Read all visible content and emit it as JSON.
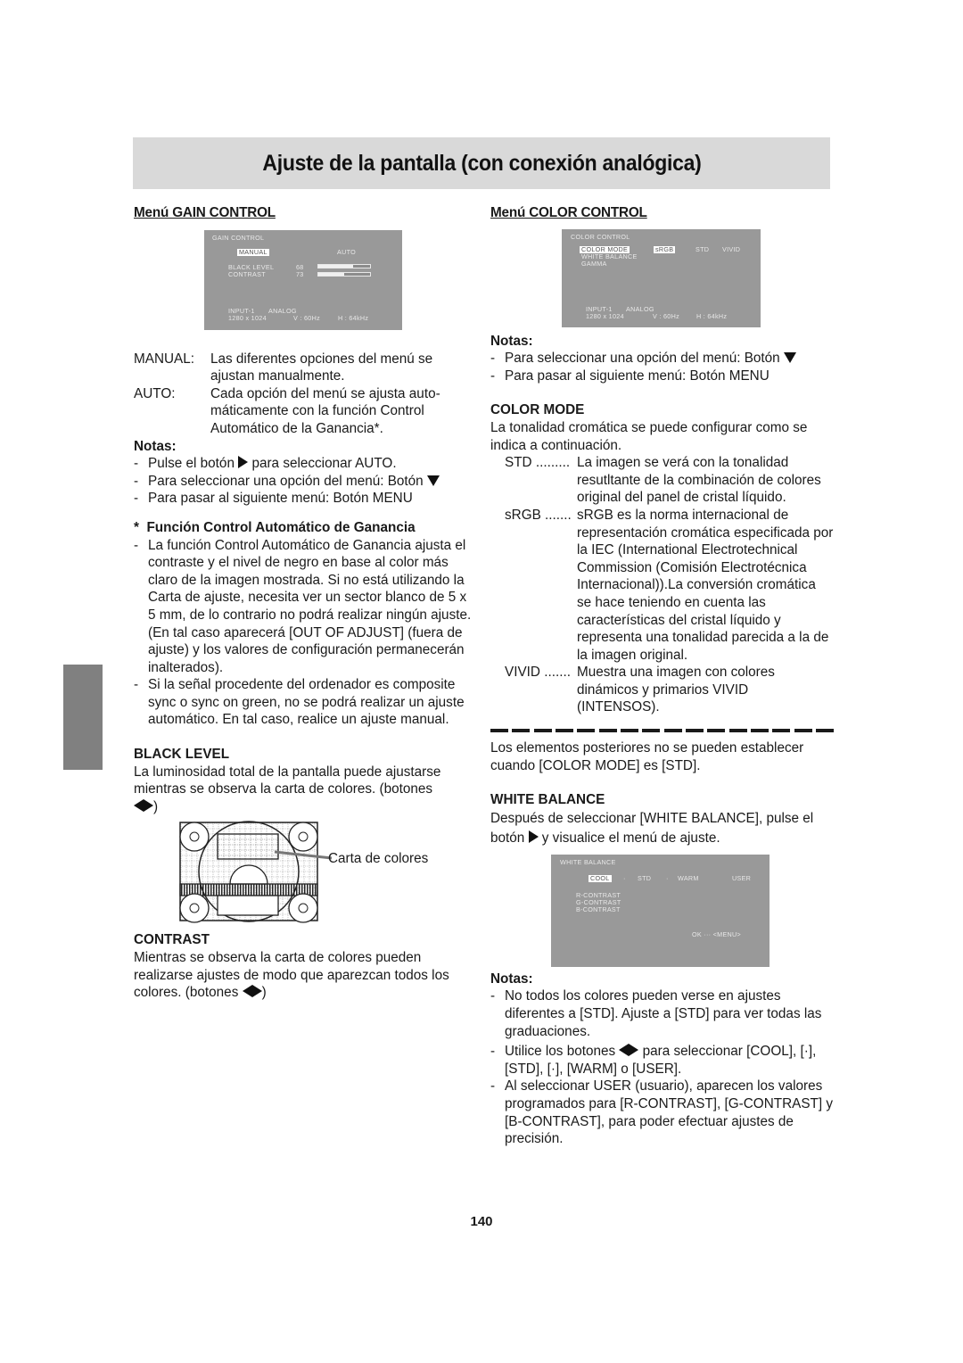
{
  "page": {
    "title": "Ajuste de la pantalla (con conexión analógica)",
    "page_number": "140"
  },
  "left": {
    "heading": "Menú GAIN CONTROL",
    "osd": {
      "title": "GAIN CONTROL",
      "options": [
        "MANUAL",
        "AUTO"
      ],
      "selected": "MANUAL",
      "items": [
        {
          "label": "BLACK LEVEL",
          "value": "68",
          "fraction": 0.68
        },
        {
          "label": "CONTRAST",
          "value": "73",
          "fraction": 0.5
        }
      ],
      "input": "INPUT-1",
      "signal": "ANALOG",
      "resolution": "1280  x 1024",
      "vfreq": "V : 60Hz",
      "hfreq": "H : 64kHz"
    },
    "defs": [
      {
        "term": "MANUAL:",
        "desc": "Las diferentes opciones del menú se ajustan manualmente."
      },
      {
        "term": "AUTO:",
        "desc": "Cada opción del menú se ajusta auto-máticamente con la función Control Automático de la Ganancia*."
      }
    ],
    "notes_title": "Notas:",
    "notes": [
      {
        "pre": "Pulse el botón",
        "icon": "right",
        "post": "para seleccionar AUTO."
      },
      {
        "pre": "Para seleccionar una opción del menú: Botón",
        "icon": "down",
        "post": ""
      },
      {
        "pre": "Para pasar al siguiente menú: Botón MENU",
        "icon": "",
        "post": ""
      }
    ],
    "agc_title": "*  Función Control Automático de Ganancia",
    "agc_notes": [
      "La función Control Automático de Ganancia ajusta el contraste y el nivel de negro en base al color más claro de la imagen mostrada. Si no está utilizando la Carta de ajuste, necesita ver un sector blanco de 5 x 5 mm, de lo contrario no podrá realizar ningún ajuste. (En tal caso aparecerá [OUT OF ADJUST] (fuera de ajuste) y los valores de configuración permanecerán inalterados).",
      "Si la señal procedente del ordenador es composite sync o sync on green, no se podrá realizar un ajuste automático. En tal caso, realice un ajuste manual."
    ],
    "black_level": {
      "title": "BLACK LEVEL",
      "text": "La luminosidad total de la pantalla puede ajustarse mientras se observa la carta de colores. (botones",
      "close": ")"
    },
    "chart_callout": "Carta de colores",
    "contrast": {
      "title": "CONTRAST",
      "text": "Mientras se observa la carta de colores pueden realizarse ajustes de modo que aparezcan todos los colores. (botones",
      "close": ")"
    }
  },
  "right": {
    "heading": "Menú COLOR CONTROL",
    "osd": {
      "title": "COLOR CONTROL",
      "items": [
        "COLOR MODE",
        "WHITE BALANCE",
        "GAMMA"
      ],
      "mode_options": [
        "sRGB",
        "STD",
        "VIVID"
      ],
      "selected_item": "COLOR MODE",
      "selected_mode": "sRGB",
      "input": "INPUT-1",
      "signal": "ANALOG",
      "resolution": "1280  x 1024",
      "vfreq": "V : 60Hz",
      "hfreq": "H : 64kHz"
    },
    "notes_title": "Notas:",
    "notes": [
      {
        "pre": "Para seleccionar una opción del menú: Botón",
        "icon": "down",
        "post": ""
      },
      {
        "pre": "Para pasar al siguiente menú: Botón MENU",
        "icon": "",
        "post": ""
      }
    ],
    "color_mode": {
      "title": "COLOR MODE",
      "intro": "La tonalidad cromática se puede configurar como se indica a continuación.",
      "modes": [
        {
          "term": "STD .........",
          "desc": "La imagen se verá con la tonalidad resutltante de la combinación de colores original del panel de cristal líquido."
        },
        {
          "term": "sRGB .......",
          "desc": "sRGB es la norma internacional de representación cromática especificada por la IEC (International Electrotechnical Commission (Comisión Electrotécnica Internacional)).La conversión cromática se hace teniendo en cuenta las características del cristal líquido y representa una tonalidad parecida a la de la imagen original."
        },
        {
          "term": "VIVID .......",
          "desc": "Muestra una imagen con colores dinámicos y primarios VIVID (INTENSOS)."
        }
      ]
    },
    "std_note": "Los elementos posteriores no se pueden establecer cuando [COLOR MODE] es [STD].",
    "white_balance": {
      "title": "WHITE BALANCE",
      "text_pre": "Después de seleccionar [WHITE BALANCE], pulse el botón",
      "text_post": "y visualice el menú de ajuste.",
      "osd": {
        "title": "WHITE BALANCE",
        "options": [
          "COOL",
          "·",
          "STD",
          "·",
          "WARM",
          "USER"
        ],
        "selected": "COOL",
        "items": [
          "R-CONTRAST",
          "G-CONTRAST",
          "B-CONTRAST"
        ],
        "footer": "OK ··· <MENU>"
      }
    },
    "notes2_title": "Notas:",
    "notes2": [
      {
        "pre": "No todos los colores pueden verse en ajustes diferentes a [STD]. Ajuste a [STD] para ver todas las graduaciones.",
        "icons": false,
        "post": ""
      },
      {
        "pre": "Utilice los botones",
        "icons": true,
        "post": "para seleccionar [COOL], [·], [STD], [·], [WARM] o [USER]."
      },
      {
        "pre": "Al seleccionar USER (usuario), aparecen los valores programados para [R-CONTRAST], [G-CONTRAST] y [B-CONTRAST], para poder efectuar ajustes de precisión.",
        "icons": false,
        "post": ""
      }
    ]
  },
  "colors": {
    "title_bar_bg": "#d9d9d9",
    "osd_bg": "#999999",
    "side_tab": "#808080"
  }
}
